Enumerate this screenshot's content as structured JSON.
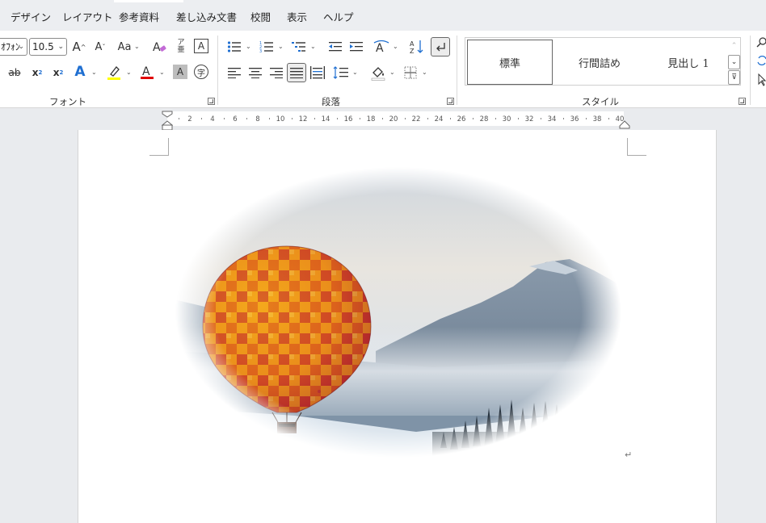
{
  "menu": {
    "tabs": [
      "デザイン",
      "レイアウト",
      "参考資料",
      "差し込み文書",
      "校閲",
      "表示",
      "ヘルプ"
    ]
  },
  "font_group": {
    "font_name": "ｵﾌｫﾝ",
    "font_size": "10.5",
    "change_case": "Aa",
    "label": "フォント"
  },
  "paragraph_group": {
    "label": "段落"
  },
  "styles_group": {
    "label": "スタイル",
    "items": [
      "標準",
      "行間詰め",
      "見出し 1"
    ]
  },
  "ruler": {
    "ticks": [
      "2",
      "4",
      "6",
      "8",
      "10",
      "12",
      "14",
      "16",
      "18",
      "20",
      "22",
      "24",
      "26",
      "28",
      "30",
      "32",
      "34",
      "36",
      "38",
      "40"
    ]
  },
  "colors": {
    "highlight": "#ffff00",
    "font_color": "#e00000",
    "text_effect": "#1f6fd1",
    "ribbon_bg": "#ffffff",
    "app_bg": "#e9ebee"
  },
  "icons": {
    "grow_font": "grow-font-icon",
    "shrink_font": "shrink-font-icon",
    "clear_format": "clear-formatting-icon",
    "phonetic": "phonetic-guide-icon",
    "char_border": "character-border-icon",
    "strikethrough": "strikethrough-icon",
    "subscript": "subscript-icon",
    "superscript": "superscript-icon",
    "text_effects": "text-effects-icon",
    "highlight": "highlighter-icon",
    "font_color": "font-color-icon",
    "char_shading": "character-shading-icon",
    "enclosed_char": "enclosed-character-icon",
    "bullets": "bullets-icon",
    "numbering": "numbering-icon",
    "multilevel": "multilevel-list-icon",
    "decrease_indent": "decrease-indent-icon",
    "increase_indent": "increase-indent-icon",
    "asian_layout": "asian-layout-icon",
    "sort": "sort-icon",
    "show_marks": "show-formatting-marks-icon",
    "align_left": "align-left-icon",
    "align_center": "align-center-icon",
    "align_right": "align-right-icon",
    "justify": "justify-icon",
    "distributed": "distributed-icon",
    "line_spacing": "line-spacing-icon",
    "shading": "shading-icon",
    "borders": "borders-icon",
    "find": "find-icon",
    "replace": "replace-icon",
    "select": "select-icon"
  }
}
